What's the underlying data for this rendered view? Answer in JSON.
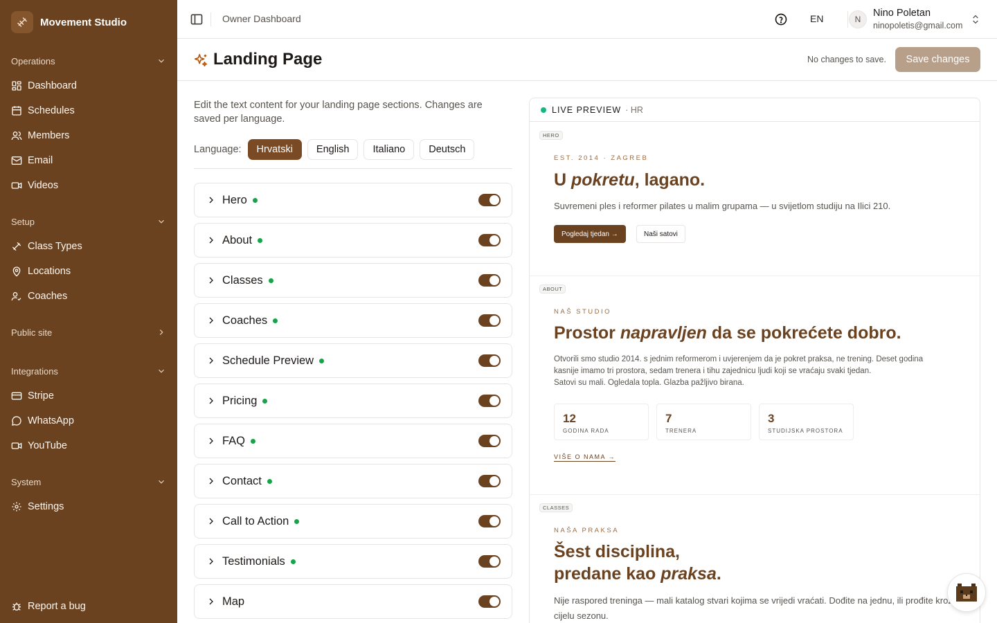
{
  "app": {
    "name": "Movement Studio"
  },
  "sidebar": {
    "groups": [
      {
        "label": "Operations",
        "items": [
          "Dashboard",
          "Schedules",
          "Members",
          "Email",
          "Videos"
        ]
      },
      {
        "label": "Setup",
        "items": [
          "Class Types",
          "Locations",
          "Coaches"
        ]
      },
      {
        "label": "Public site",
        "items": []
      },
      {
        "label": "Integrations",
        "items": [
          "Stripe",
          "WhatsApp",
          "YouTube"
        ]
      },
      {
        "label": "System",
        "items": [
          "Settings"
        ]
      }
    ],
    "report_bug": "Report a bug"
  },
  "topbar": {
    "breadcrumb": "Owner Dashboard",
    "lang_code": "EN",
    "user": {
      "initial": "N",
      "name": "Nino Poletan",
      "email": "ninopoletis@gmail.com"
    }
  },
  "page": {
    "title": "Landing Page",
    "save_status": "No changes to save.",
    "save_label": "Save changes"
  },
  "editor": {
    "intro": "Edit the text content for your landing page sections. Changes are saved per language.",
    "language_label": "Language:",
    "languages": [
      "Hrvatski",
      "English",
      "Italiano",
      "Deutsch"
    ],
    "active_language": "Hrvatski",
    "sections": [
      {
        "name": "Hero",
        "has_content": true,
        "enabled": true
      },
      {
        "name": "About",
        "has_content": true,
        "enabled": true
      },
      {
        "name": "Classes",
        "has_content": true,
        "enabled": true
      },
      {
        "name": "Coaches",
        "has_content": true,
        "enabled": true
      },
      {
        "name": "Schedule Preview",
        "has_content": true,
        "enabled": true
      },
      {
        "name": "Pricing",
        "has_content": true,
        "enabled": true
      },
      {
        "name": "FAQ",
        "has_content": true,
        "enabled": true
      },
      {
        "name": "Contact",
        "has_content": true,
        "enabled": true
      },
      {
        "name": "Call to Action",
        "has_content": true,
        "enabled": true
      },
      {
        "name": "Testimonials",
        "has_content": true,
        "enabled": true
      },
      {
        "name": "Map",
        "has_content": false,
        "enabled": true
      }
    ]
  },
  "preview": {
    "label": "LIVE PREVIEW",
    "lang": "· HR",
    "hero": {
      "tag": "HERO",
      "eyebrow": "EST. 2014 · ZAGREB",
      "title_pre": "U ",
      "title_em": "pokretu",
      "title_post": ", lagano.",
      "subtitle": "Suvremeni ples i reformer pilates u malim grupama — u svijetlom studiju na Ilici 210.",
      "primary_btn": "Pogledaj tjedan →",
      "secondary_btn": "Naši satovi"
    },
    "about": {
      "tag": "ABOUT",
      "eyebrow": "NAŠ STUDIO",
      "title_pre": "Prostor ",
      "title_em": "napravljen",
      "title_post": " da se pokrećete dobro.",
      "body1": "Otvorili smo studio 2014. s jednim reformerom i uvjerenjem da je pokret praksa, ne trening. Deset godina kasnije imamo tri prostora, sedam trenera i tihu zajednicu ljudi koji se vraćaju svaki tjedan.",
      "body2": "Satovi su mali. Ogledala topla. Glazba pažljivo birana.",
      "stats": [
        {
          "value": "12",
          "label": "GODINA RADA"
        },
        {
          "value": "7",
          "label": "TRENERA"
        },
        {
          "value": "3",
          "label": "STUDIJSKA PROSTORA"
        }
      ],
      "link": "VIŠE O NAMA →"
    },
    "classes": {
      "tag": "CLASSES",
      "eyebrow": "NAŠA PRAKSA",
      "title_line1": "Šest disciplina,",
      "title_pre": "predane kao ",
      "title_em": "praksa",
      "title_post": ".",
      "body": "Nije raspored treninga — mali katalog stvari kojima se vrijedi vraćati. Dođite na jednu, ili prođite kroz cijelu sezonu."
    }
  },
  "colors": {
    "sidebar": "#6b4220",
    "accent": "#7a4a24",
    "status_dot": "#16a34a",
    "live_dot": "#10b981"
  }
}
